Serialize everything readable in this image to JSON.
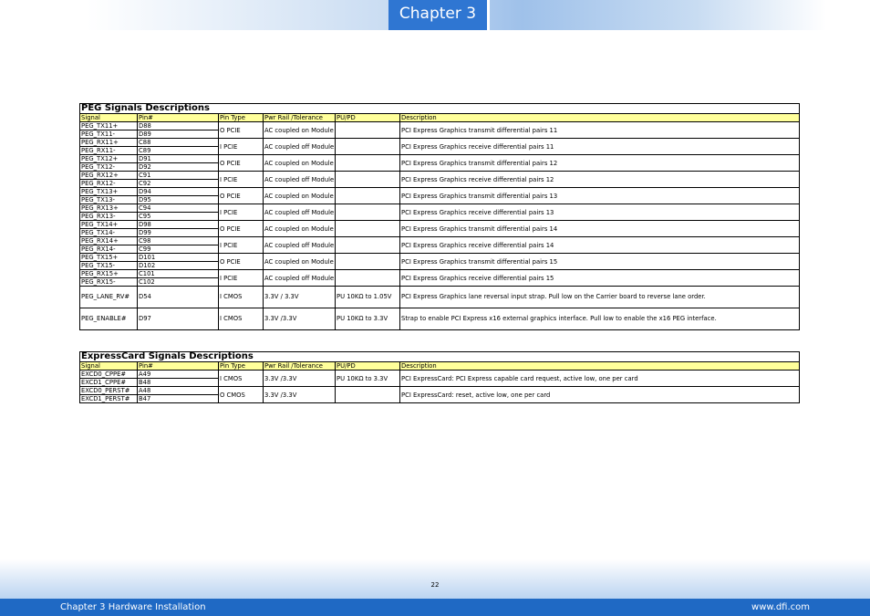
{
  "header": {
    "chapter_tab": "Chapter 3"
  },
  "peg": {
    "title": "PEG Signals Descriptions",
    "columns": [
      "Signal",
      "Pin#",
      "Pin Type",
      "Pwr Rail /Tolerance",
      "PU/PD",
      "Description"
    ],
    "groups": [
      {
        "rows": [
          [
            "PEG_TX11+",
            "D88"
          ],
          [
            "PEG_TX11-",
            "D89"
          ]
        ],
        "type": "O PCIE",
        "rail": "AC coupled on Module",
        "pupd": "",
        "desc": "PCI Express Graphics transmit differential pairs 11"
      },
      {
        "rows": [
          [
            "PEG_RX11+",
            "C88"
          ],
          [
            "PEG_RX11-",
            "C89"
          ]
        ],
        "type": "I PCIE",
        "rail": "AC coupled off Module",
        "pupd": "",
        "desc": "PCI Express Graphics receive differential pairs 11"
      },
      {
        "rows": [
          [
            "PEG_TX12+",
            "D91"
          ],
          [
            "PEG_TX12-",
            "D92"
          ]
        ],
        "type": "O PCIE",
        "rail": "AC coupled on Module",
        "pupd": "",
        "desc": "PCI Express Graphics transmit differential pairs 12"
      },
      {
        "rows": [
          [
            "PEG_RX12+",
            "C91"
          ],
          [
            "PEG_RX12-",
            "C92"
          ]
        ],
        "type": "I PCIE",
        "rail": "AC coupled off Module",
        "pupd": "",
        "desc": "PCI Express Graphics receive differential pairs 12"
      },
      {
        "rows": [
          [
            "PEG_TX13+",
            "D94"
          ],
          [
            "PEG_TX13-",
            "D95"
          ]
        ],
        "type": "O PCIE",
        "rail": "AC coupled on Module",
        "pupd": "",
        "desc": "PCI Express Graphics transmit differential pairs 13"
      },
      {
        "rows": [
          [
            "PEG_RX13+",
            "C94"
          ],
          [
            "PEG_RX13-",
            "C95"
          ]
        ],
        "type": "I PCIE",
        "rail": "AC coupled off Module",
        "pupd": "",
        "desc": "PCI Express Graphics receive differential pairs 13"
      },
      {
        "rows": [
          [
            "PEG_TX14+",
            "D98"
          ],
          [
            "PEG_TX14-",
            "D99"
          ]
        ],
        "type": "O PCIE",
        "rail": "AC coupled on Module",
        "pupd": "",
        "desc": "PCI Express Graphics transmit differential pairs 14"
      },
      {
        "rows": [
          [
            "PEG_RX14+",
            "C98"
          ],
          [
            "PEG_RX14-",
            "C99"
          ]
        ],
        "type": "I PCIE",
        "rail": "AC coupled off Module",
        "pupd": "",
        "desc": "PCI Express Graphics receive differential pairs 14"
      },
      {
        "rows": [
          [
            "PEG_TX15+",
            "D101"
          ],
          [
            "PEG_TX15-",
            "D102"
          ]
        ],
        "type": "O PCIE",
        "rail": "AC coupled on Module",
        "pupd": "",
        "desc": "PCI Express Graphics transmit differential pairs 15"
      },
      {
        "rows": [
          [
            "PEG_RX15+",
            "C101"
          ],
          [
            "PEG_RX15-",
            "C102"
          ]
        ],
        "type": "I PCIE",
        "rail": "AC coupled off Module",
        "pupd": "",
        "desc": "PCI Express Graphics receive differential pairs 15"
      }
    ],
    "singles": [
      {
        "signal": "PEG_LANE_RV#",
        "pin": "D54",
        "type": "I CMOS",
        "rail": "3.3V / 3.3V",
        "pupd": "PU 10KΩ to 1.05V",
        "desc": "PCI Express Graphics lane reversal input strap. Pull low on the Carrier board to reverse lane order."
      },
      {
        "signal": "PEG_ENABLE#",
        "pin": "D97",
        "type": "I CMOS",
        "rail": "3.3V /3.3V",
        "pupd": "PU 10KΩ to 3.3V",
        "desc": "Strap to enable PCI Express x16 external graphics interface. Pull low to enable the x16 PEG interface."
      }
    ]
  },
  "expresscard": {
    "title": "ExpressCard Signals Descriptions",
    "columns": [
      "Signal",
      "Pin#",
      "Pin Type",
      "Pwr Rail /Tolerance",
      "PU/PD",
      "Description"
    ],
    "groups": [
      {
        "rows": [
          [
            "EXCD0_CPPE#",
            "A49"
          ],
          [
            "EXCD1_CPPE#",
            "B48"
          ]
        ],
        "type": "I CMOS",
        "rail": "3.3V /3.3V",
        "pupd": "PU 10KΩ to 3.3V",
        "desc": "PCI ExpressCard: PCI Express capable card request, active low, one per card"
      },
      {
        "rows": [
          [
            "EXCD0_PERST#",
            "A48"
          ],
          [
            "EXCD1_PERST#",
            "B47"
          ]
        ],
        "type": "O CMOS",
        "rail": "3.3V /3.3V",
        "pupd": "",
        "desc": "PCI ExpressCard: reset, active low, one per card"
      }
    ]
  },
  "footer": {
    "page_number": "22",
    "left": "Chapter 3 Hardware Installation",
    "right": "www.dfi.com"
  }
}
